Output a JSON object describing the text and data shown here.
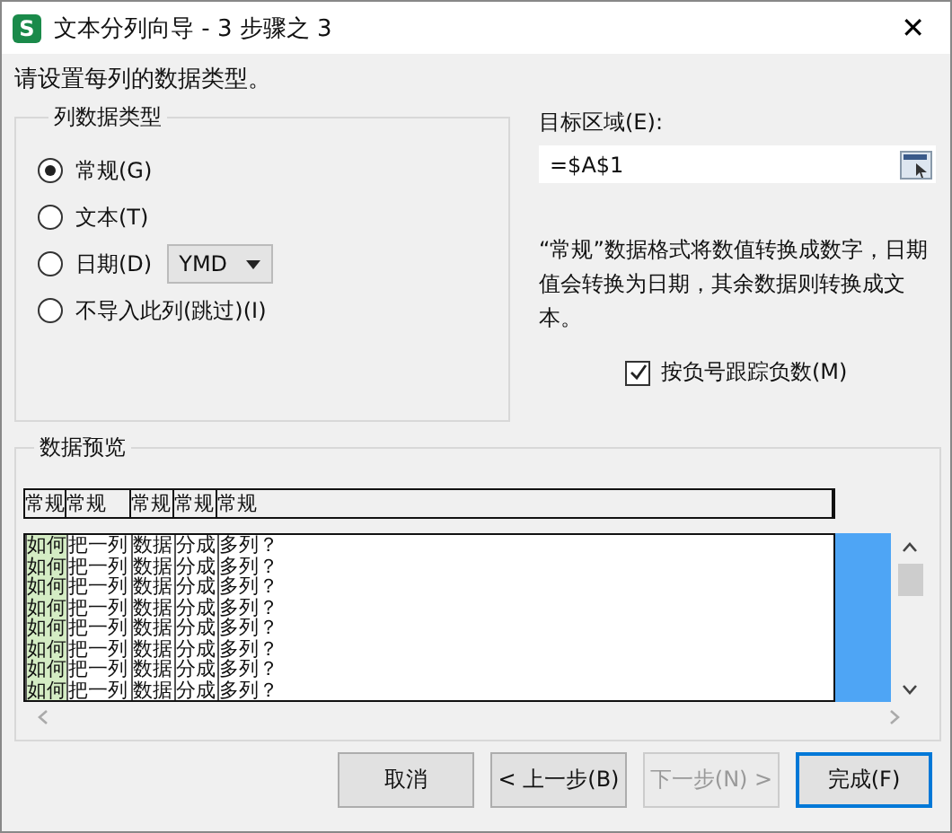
{
  "window": {
    "title": "文本分列向导 - 3 步骤之 3",
    "app_letter": "S",
    "close": "✕"
  },
  "instruction": "请设置每列的数据类型。",
  "column_format": {
    "title": "列数据类型",
    "options": [
      {
        "label": "常规(G)",
        "selected": true
      },
      {
        "label": "文本(T)",
        "selected": false
      },
      {
        "label": "日期(D)",
        "selected": false,
        "dropdown": "YMD"
      },
      {
        "label": "不导入此列(跳过)(I)",
        "selected": false
      }
    ]
  },
  "destination": {
    "label": "目标区域(E):",
    "value": "=$A$1"
  },
  "description": "“常规”数据格式将数值转换成数字，日期值会转换为日期，其余数据则转换成文本。",
  "negative_checkbox": {
    "label": "按负号跟踪负数(M)",
    "checked": true
  },
  "preview": {
    "title": "数据预览",
    "trailing_selection": true,
    "columns": [
      {
        "label": "常规",
        "selected": true
      },
      {
        "label": "常规",
        "selected": false
      },
      {
        "label": "常规",
        "selected": false
      },
      {
        "label": "常规",
        "selected": false
      },
      {
        "label": "常规",
        "selected": false
      }
    ],
    "rows": [
      [
        "如何",
        "把一列",
        "数据",
        "分成",
        "多列？"
      ],
      [
        "如何",
        "把一列",
        "数据",
        "分成",
        "多列？"
      ],
      [
        "如何",
        "把一列",
        "数据",
        "分成",
        "多列？"
      ],
      [
        "如何",
        "把一列",
        "数据",
        "分成",
        "多列？"
      ],
      [
        "如何",
        "把一列",
        "数据",
        "分成",
        "多列？"
      ],
      [
        "如何",
        "把一列",
        "数据",
        "分成",
        "多列？"
      ],
      [
        "如何",
        "把一列",
        "数据",
        "分成",
        "多列？"
      ],
      [
        "如何",
        "把一列",
        "数据",
        "分成",
        "多列？"
      ]
    ]
  },
  "buttons": [
    {
      "label": "取消",
      "disabled": false,
      "default": false
    },
    {
      "label": "< 上一步(B)",
      "disabled": false,
      "default": false
    },
    {
      "label": "下一步(N) >",
      "disabled": true,
      "default": false
    },
    {
      "label": "完成(F)",
      "disabled": false,
      "default": true
    }
  ]
}
